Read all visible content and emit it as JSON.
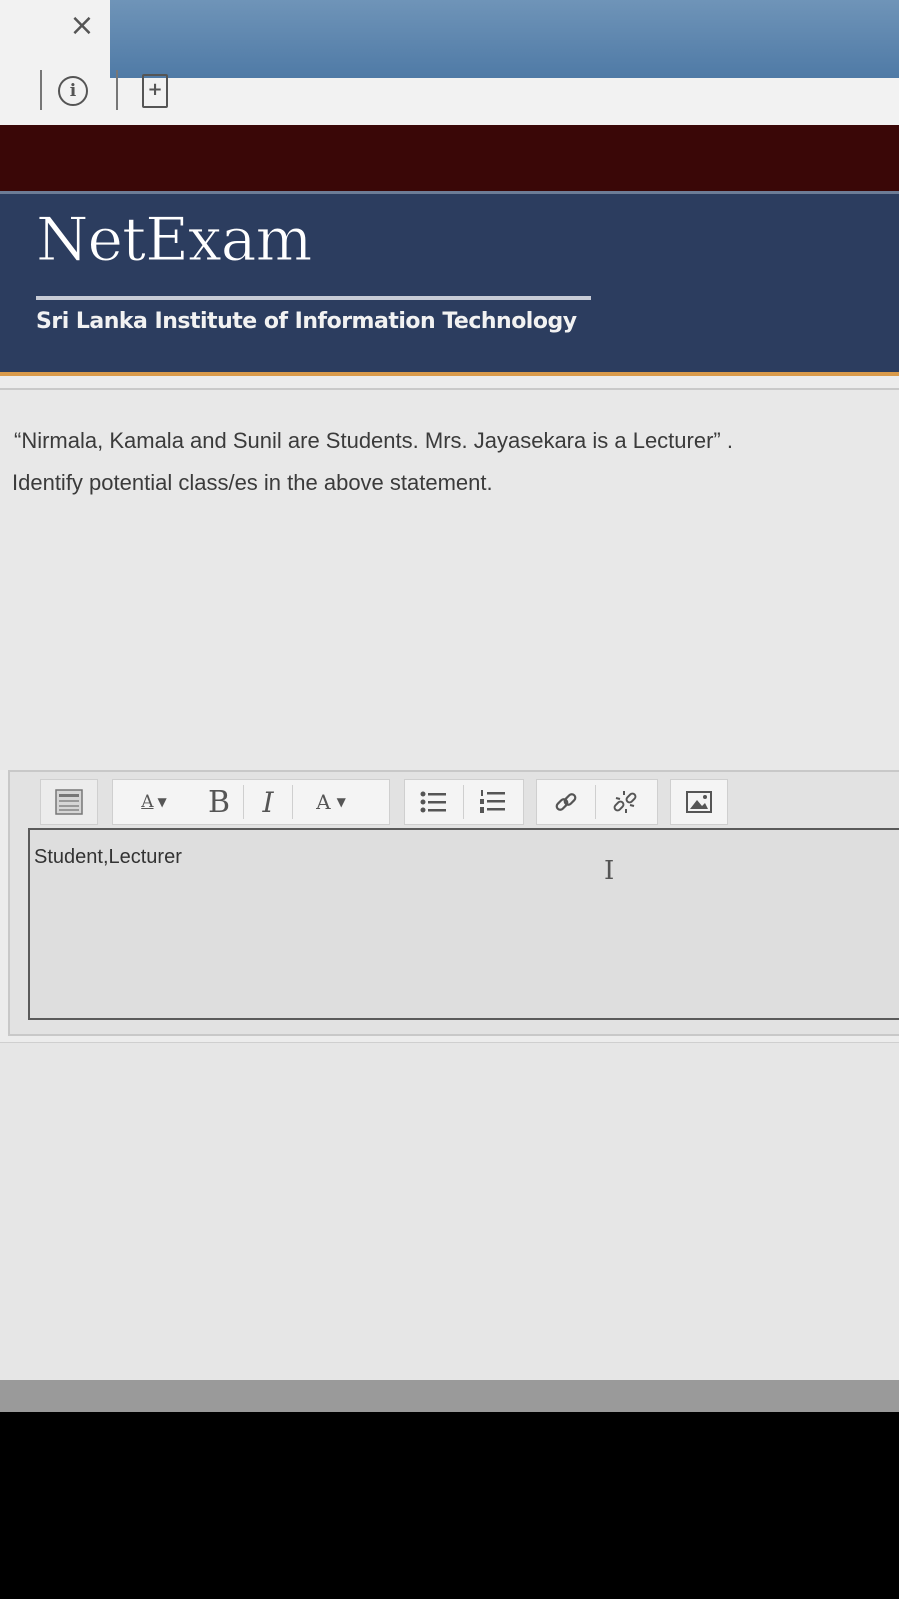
{
  "browser": {
    "close_glyph": "×",
    "info_glyph": "i",
    "page_add_glyph": "+"
  },
  "banner": {
    "brand": "NetExam",
    "institute": "Sri Lanka Institute of Information Technology"
  },
  "question": {
    "line1": "“Nirmala, Kamala and Sunil are Students. Mrs. Jayasekara is a Lecturer” .",
    "line2": "Identify potential class/es in the above statement."
  },
  "editor": {
    "toolbar": {
      "format_label": "A",
      "bold_label": "B",
      "italic_label": "I",
      "color_label": "A",
      "icons": [
        "toolbar-toggle-icon",
        "paragraph-format-icon",
        "bold-icon",
        "italic-icon",
        "font-color-icon",
        "unordered-list-icon",
        "ordered-list-icon",
        "link-icon",
        "unlink-icon",
        "image-icon"
      ]
    },
    "value": "Student,Lecturer",
    "cursor_glyph": "I"
  },
  "colors": {
    "maroon": "#3a0707",
    "banner": "#2c3d5f",
    "accent_orange": "#d99a4a",
    "browser_blue": "#5a84ae"
  }
}
